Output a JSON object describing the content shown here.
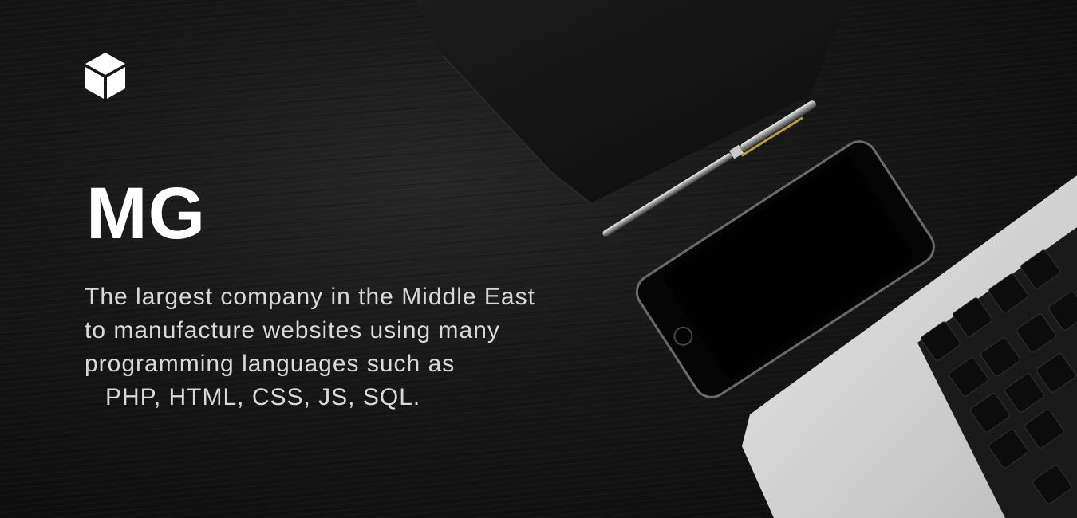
{
  "hero": {
    "logo_icon": "cube-icon",
    "title": "MG",
    "tagline_lines": [
      "The largest company in the Middle East",
      "to manufacture websites using many",
      "programming languages such as",
      "PHP, HTML, CSS, JS, SQL."
    ]
  },
  "scene": {
    "objects": [
      "notebook",
      "pen",
      "smartphone",
      "laptop"
    ]
  },
  "colors": {
    "background": "#141414",
    "text_primary": "#ffffff",
    "text_secondary": "#d9d9d9"
  }
}
